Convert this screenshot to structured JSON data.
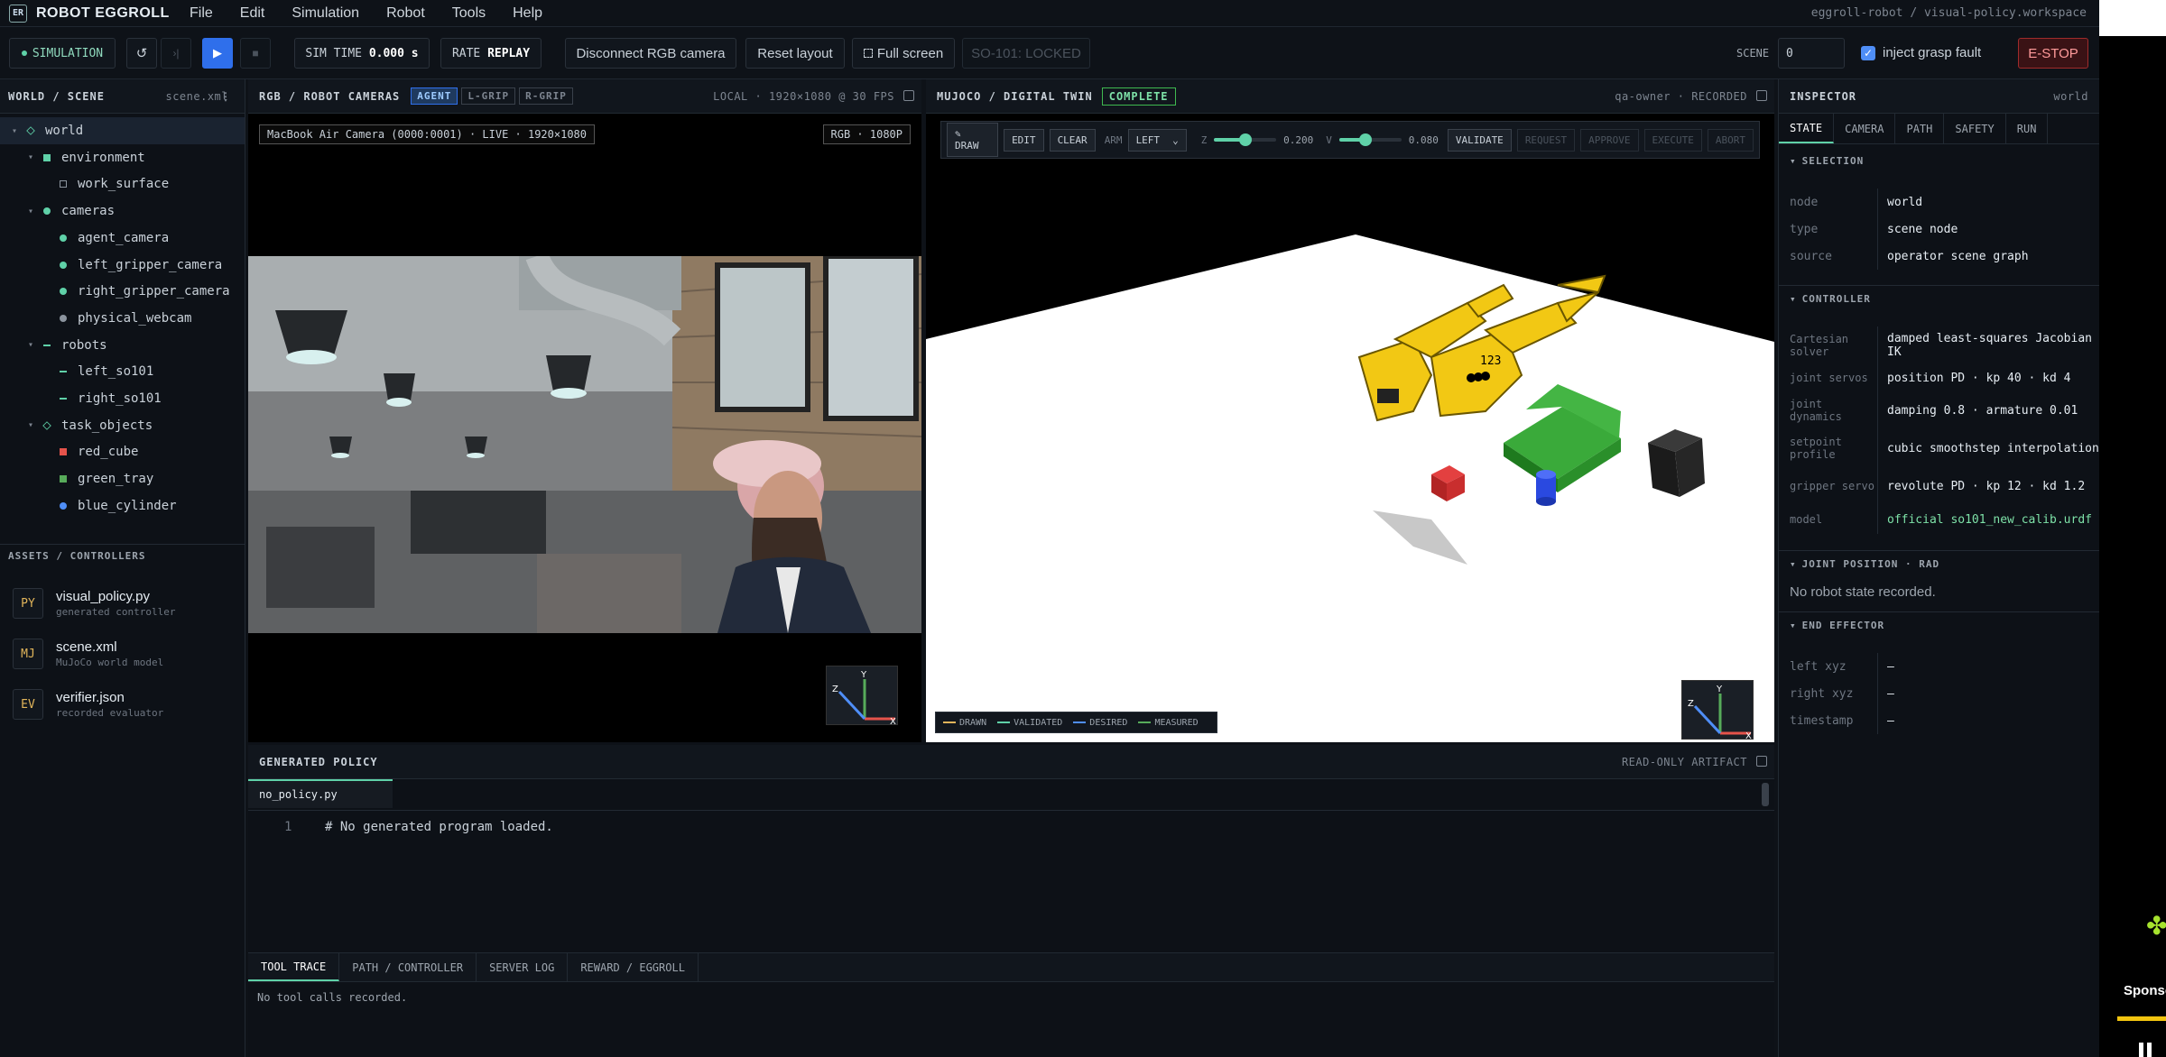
{
  "app": {
    "logo_badge": "ER",
    "title": "ROBOT EGGROLL",
    "workspace": "eggroll-robot / visual-policy.workspace"
  },
  "menu": [
    "File",
    "Edit",
    "Simulation",
    "Robot",
    "Tools",
    "Help"
  ],
  "toolbar": {
    "mode": "SIMULATION",
    "reset_icon": "↺",
    "step_icon": "›|",
    "play_icon": "▶",
    "stop_icon": "■",
    "sim_time_label": "SIM TIME",
    "sim_time_value": "0.000 s",
    "rate_label": "RATE",
    "rate_value": "REPLAY",
    "disconnect": "Disconnect RGB camera",
    "reset_layout": "Reset layout",
    "full_screen": "Full screen",
    "robot_lock": "SO-101: LOCKED",
    "scene_label": "SCENE",
    "scene_value": "0",
    "inject_label": "inject grasp fault",
    "estop": "E-STOP"
  },
  "left": {
    "header": "WORLD / SCENE",
    "file": "scene.xml",
    "tree": [
      {
        "label": "world",
        "caret": "▾",
        "indent": 0,
        "icon": "diamond",
        "color": "#5fd1a8"
      },
      {
        "label": "environment",
        "caret": "▾",
        "indent": 1,
        "icon": "square",
        "color": "#5fd1a8"
      },
      {
        "label": "work_surface",
        "caret": "",
        "indent": 2,
        "icon": "hollow",
        "color": "#8b949e"
      },
      {
        "label": "cameras",
        "caret": "▾",
        "indent": 1,
        "icon": "circle",
        "color": "#5fd1a8"
      },
      {
        "label": "agent_camera",
        "caret": "",
        "indent": 2,
        "icon": "circle",
        "color": "#5fd1a8"
      },
      {
        "label": "left_gripper_camera",
        "caret": "",
        "indent": 2,
        "icon": "circle",
        "color": "#5fd1a8"
      },
      {
        "label": "right_gripper_camera",
        "caret": "",
        "indent": 2,
        "icon": "circle",
        "color": "#5fd1a8"
      },
      {
        "label": "physical_webcam",
        "caret": "",
        "indent": 2,
        "icon": "circle",
        "color": "#8b949e"
      },
      {
        "label": "robots",
        "caret": "▾",
        "indent": 1,
        "icon": "dash",
        "color": "#5fd1a8"
      },
      {
        "label": "left_so101",
        "caret": "",
        "indent": 2,
        "icon": "dash",
        "color": "#5fd1a8"
      },
      {
        "label": "right_so101",
        "caret": "",
        "indent": 2,
        "icon": "dash",
        "color": "#5fd1a8"
      },
      {
        "label": "task_objects",
        "caret": "▾",
        "indent": 1,
        "icon": "diamond",
        "color": "#5fd1a8"
      },
      {
        "label": "red_cube",
        "caret": "",
        "indent": 2,
        "icon": "square",
        "color": "#e5534b"
      },
      {
        "label": "green_tray",
        "caret": "",
        "indent": 2,
        "icon": "square",
        "color": "#57ab5a"
      },
      {
        "label": "blue_cylinder",
        "caret": "",
        "indent": 2,
        "icon": "circle",
        "color": "#4f8ef7"
      }
    ],
    "assets_header": "ASSETS / CONTROLLERS",
    "assets": [
      {
        "badge": "PY",
        "name": "visual_policy.py",
        "desc": "generated controller"
      },
      {
        "badge": "MJ",
        "name": "scene.xml",
        "desc": "MuJoCo world model"
      },
      {
        "badge": "EV",
        "name": "verifier.json",
        "desc": "recorded evaluator"
      }
    ]
  },
  "camera": {
    "header": "RGB / ROBOT CAMERAS",
    "tabs": [
      "AGENT",
      "L-GRIP",
      "R-GRIP"
    ],
    "status": "LOCAL · 1920×1080 @ 30 FPS",
    "overlay_source": "MacBook Air Camera (0000:0001) · LIVE · 1920×1080",
    "overlay_res": "RGB · 1080P"
  },
  "twin": {
    "header": "MUJOCO / DIGITAL TWIN",
    "status": "COMPLETE",
    "owner": "qa-owner · RECORDED",
    "draw": "✎ DRAW",
    "edit": "EDIT",
    "clear": "CLEAR",
    "arm_label": "ARM",
    "arm_value": "LEFT",
    "z_label": "Z",
    "z_value": "0.200",
    "v_label": "V",
    "v_value": "0.080",
    "validate": "VALIDATE",
    "request": "REQUEST",
    "approve": "APPROVE",
    "execute": "EXECUTE",
    "abort": "ABORT",
    "waypoint_label": "123",
    "legend": [
      {
        "label": "DRAWN",
        "color": "#e0b45a"
      },
      {
        "label": "VALIDATED",
        "color": "#5fd1a8"
      },
      {
        "label": "DESIRED",
        "color": "#4f8ef7"
      },
      {
        "label": "MEASURED",
        "color": "#57ab5a"
      }
    ],
    "z_fraction": 0.5,
    "v_fraction": 0.42
  },
  "inspector": {
    "header": "INSPECTOR",
    "context": "world",
    "tabs": [
      "STATE",
      "CAMERA",
      "PATH",
      "SAFETY",
      "RUN"
    ],
    "selection_header": "SELECTION",
    "selection": [
      {
        "k": "node",
        "v": "world"
      },
      {
        "k": "type",
        "v": "scene node"
      },
      {
        "k": "source",
        "v": "operator scene graph"
      }
    ],
    "controller_header": "CONTROLLER",
    "controller": [
      {
        "k": "Cartesian solver",
        "v": "damped least-squares Jacobian IK"
      },
      {
        "k": "joint servos",
        "v": "position PD · kp 40 · kd 4"
      },
      {
        "k": "joint dynamics",
        "v": "damping 0.8 · armature 0.01"
      },
      {
        "k": "setpoint profile",
        "v": "cubic smoothstep interpolation"
      },
      {
        "k": "gripper servo",
        "v": "revolute PD · kp 12 · kd 1.2"
      },
      {
        "k": "model",
        "v": "official so101_new_calib.urdf"
      }
    ],
    "joint_header": "JOINT POSITION · RAD",
    "joint_empty": "No robot state recorded.",
    "ee_header": "END EFFECTOR",
    "ee": [
      {
        "k": "left xyz",
        "v": "—"
      },
      {
        "k": "right xyz",
        "v": "—"
      },
      {
        "k": "timestamp",
        "v": "—"
      }
    ]
  },
  "policy": {
    "header": "GENERATED POLICY",
    "artifact": "READ-ONLY ARTIFACT",
    "file_tab": "no_policy.py",
    "line_no": "1",
    "code": "# No generated program loaded."
  },
  "trace": {
    "tabs": [
      "TOOL TRACE",
      "PATH / CONTROLLER",
      "SERVER LOG",
      "REWARD / EGGROLL"
    ],
    "empty": "No tool calls recorded."
  },
  "edge": {
    "sponsor": "Sponso",
    "clover": "✤"
  }
}
